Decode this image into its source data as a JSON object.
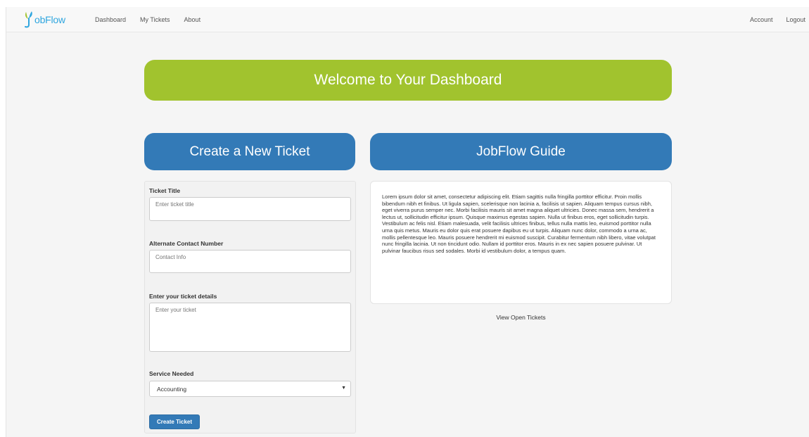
{
  "brand": {
    "name": "JobFlow",
    "logo_text": "obFlow",
    "logo_glyph": "J",
    "logo_icon": "leaf-j-icon"
  },
  "nav": {
    "left": [
      "Dashboard",
      "My Tickets",
      "About"
    ],
    "right": [
      "Account",
      "Logout"
    ]
  },
  "banner": {
    "title": "Welcome to Your Dashboard"
  },
  "create": {
    "header": "Create a New Ticket",
    "ticket_title": {
      "label": "Ticket Title",
      "placeholder": "Enter ticket title"
    },
    "contact": {
      "label": "Alternate Contact Number",
      "placeholder": "Contact Info"
    },
    "details": {
      "label": "Enter your ticket details",
      "placeholder": "Enter your ticket"
    },
    "service": {
      "label": "Service Needed",
      "selected": "Accounting",
      "arrow": "▼"
    },
    "submit_label": "Create Ticket"
  },
  "guide": {
    "header": "JobFlow Guide",
    "body": "Lorem ipsum dolor sit amet, consectetur adipiscing elit. Etiam sagittis nulla fringilla porttitor efficitur. Proin mollis bibendum nibh et finibus. Ut ligula sapien, scelerisque non lacinia a, facilisis ut sapien. Aliquam tempus cursus nibh, eget viverra purus semper nec. Morbi facilisis mauris sit amet magna aliquet ultricies. Donec massa sem, hendrerit a lectus ut, sollicitudin efficitur ipsum. Quisque maximus egestas sapien. Nulla ut finibus eros, eget sollicitudin turpis. Vestibulum ac felis nisl. Etiam malesuada, velit facilisis ultrices finibus, tellus nulla mattis leo, euismod porttitor nulla urna quis metus. Mauris eu dolor quis erat posuere dapibus eu ut turpis. Aliquam nunc dolor, commodo a urna ac, mollis pellentesque leo. Mauris posuere hendrerit mi euismod suscipit. Curabitur fermentum nibh libero, vitae volutpat nunc fringilla lacinia. Ut non tincidunt odio. Nullam id porttitor eros. Mauris in ex nec sapien posuere pulvinar. Ut pulvinar faucibus risus sed sodales. Morbi id vestibulum dolor, a tempus quam.",
    "view_link": "View Open Tickets"
  },
  "colors": {
    "banner": "#a1c32e",
    "header": "#337ab7",
    "brand": "#2fa6df",
    "button": "#337ab7"
  }
}
